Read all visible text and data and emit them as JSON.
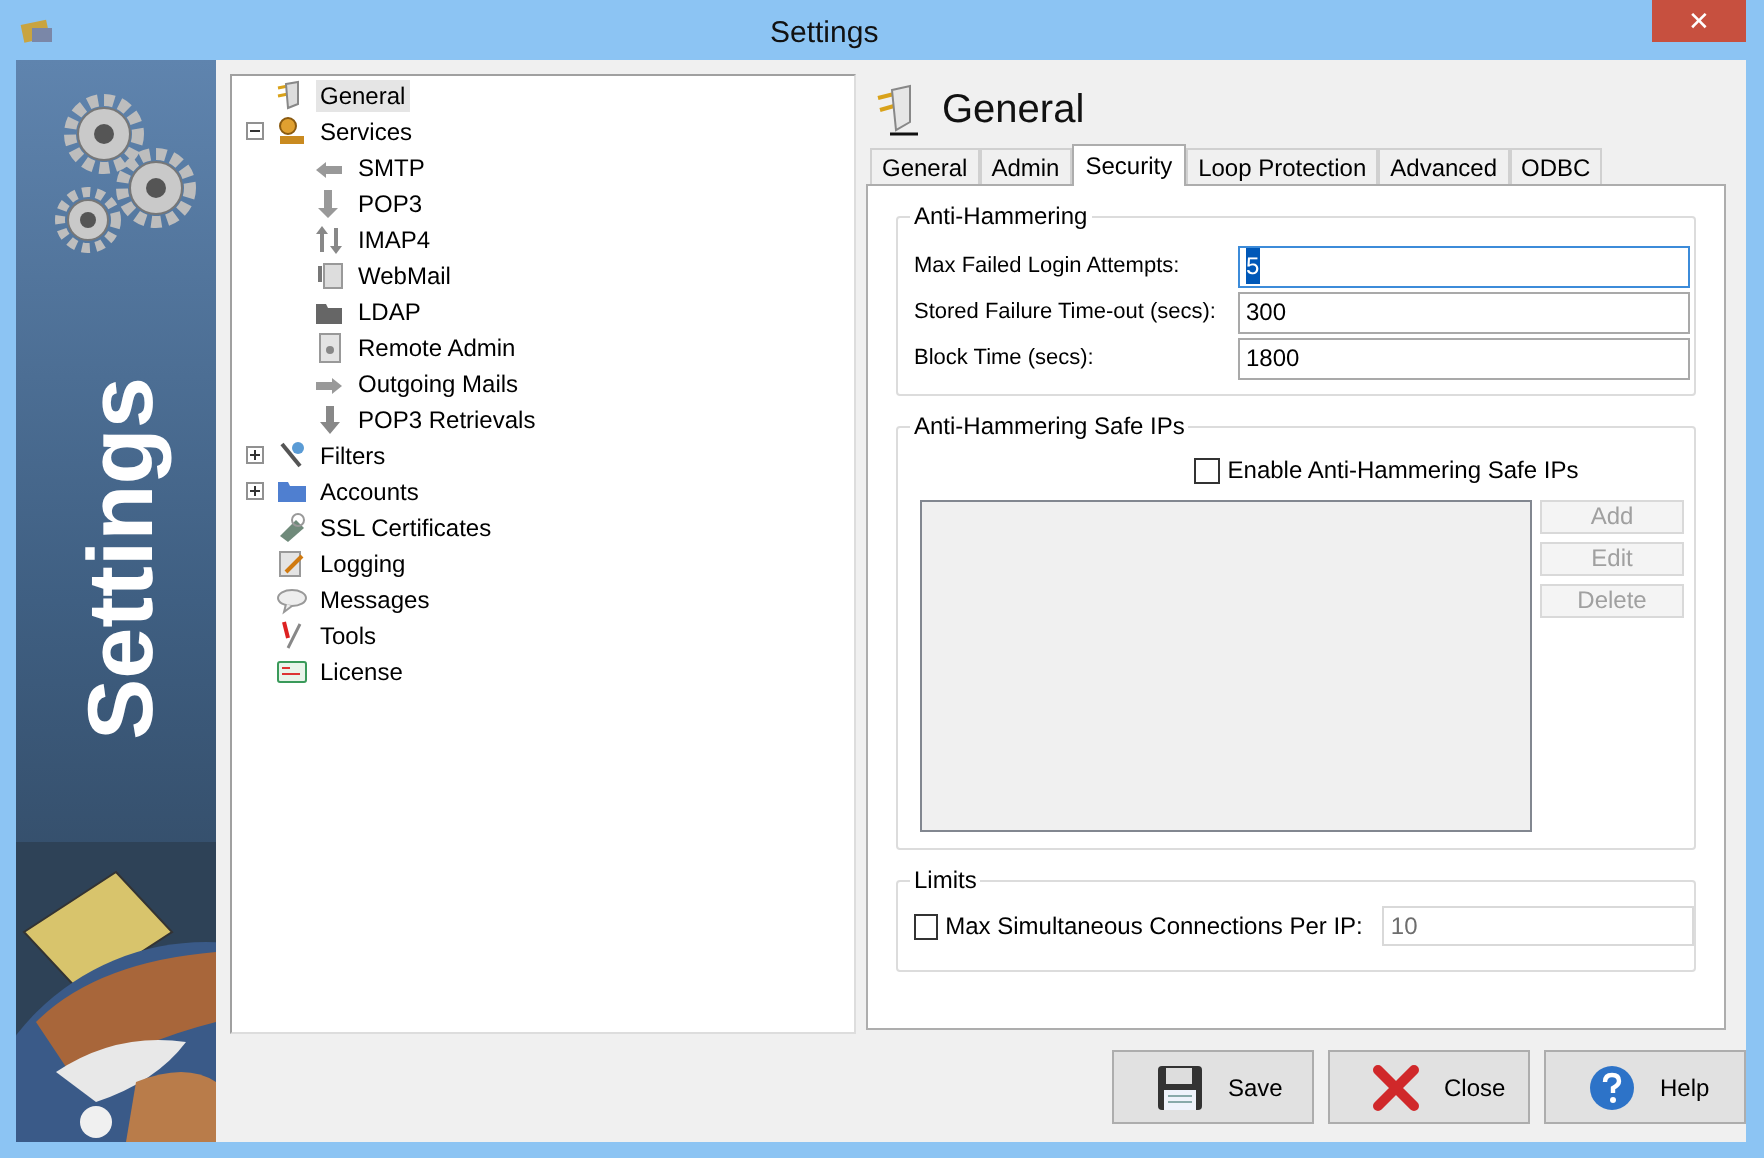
{
  "window": {
    "title": "Settings",
    "close": "✕"
  },
  "banner": {
    "title": "Settings"
  },
  "tree": [
    {
      "label": "General",
      "selected": true
    },
    {
      "label": "Services",
      "selected": false,
      "expanded": true,
      "children": [
        {
          "label": "SMTP",
          "selected": false
        },
        {
          "label": "POP3",
          "selected": false
        },
        {
          "label": "IMAP4",
          "selected": false
        },
        {
          "label": "WebMail",
          "selected": false
        },
        {
          "label": "LDAP",
          "selected": false
        },
        {
          "label": "Remote Admin",
          "selected": false
        },
        {
          "label": "Outgoing Mails",
          "selected": false
        },
        {
          "label": "POP3 Retrievals",
          "selected": false
        }
      ]
    },
    {
      "label": "Filters",
      "selected": false,
      "expanded": false
    },
    {
      "label": "Accounts",
      "selected": false,
      "expanded": false
    },
    {
      "label": "SSL Certificates",
      "selected": false
    },
    {
      "label": "Logging",
      "selected": false
    },
    {
      "label": "Messages",
      "selected": false
    },
    {
      "label": "Tools",
      "selected": false
    },
    {
      "label": "License",
      "selected": false
    }
  ],
  "page_title": "General",
  "tabs": [
    {
      "label": "General",
      "selected": false
    },
    {
      "label": "Admin",
      "selected": false
    },
    {
      "label": "Security",
      "selected": true
    },
    {
      "label": "Loop Protection",
      "selected": false
    },
    {
      "label": "Advanced",
      "selected": false
    },
    {
      "label": "ODBC",
      "selected": false
    }
  ],
  "anti_hammering": {
    "title": "Anti-Hammering",
    "fields": [
      {
        "label": "Max Failed Login Attempts:",
        "value": "5",
        "focused": true
      },
      {
        "label": "Stored Failure Time-out (secs):",
        "value": "300",
        "focused": false
      },
      {
        "label": "Block Time (secs):",
        "value": "1800",
        "focused": false
      }
    ]
  },
  "safe_ips": {
    "title": "Anti-Hammering Safe IPs",
    "enable": {
      "label": "Enable Anti-Hammering Safe IPs",
      "checked": false
    },
    "list_disabled": true,
    "buttons": [
      {
        "label": "Add",
        "disabled": true
      },
      {
        "label": "Edit",
        "disabled": true
      },
      {
        "label": "Delete",
        "disabled": true
      }
    ]
  },
  "limits": {
    "title": "Limits",
    "max_connections": {
      "label": "Max Simultaneous Connections Per IP:",
      "checked": false,
      "value": "10",
      "disabled": true
    }
  },
  "buttons": [
    {
      "label": "Save",
      "kind": "save"
    },
    {
      "label": "Close",
      "kind": "close"
    },
    {
      "label": "Help",
      "kind": "help"
    }
  ]
}
